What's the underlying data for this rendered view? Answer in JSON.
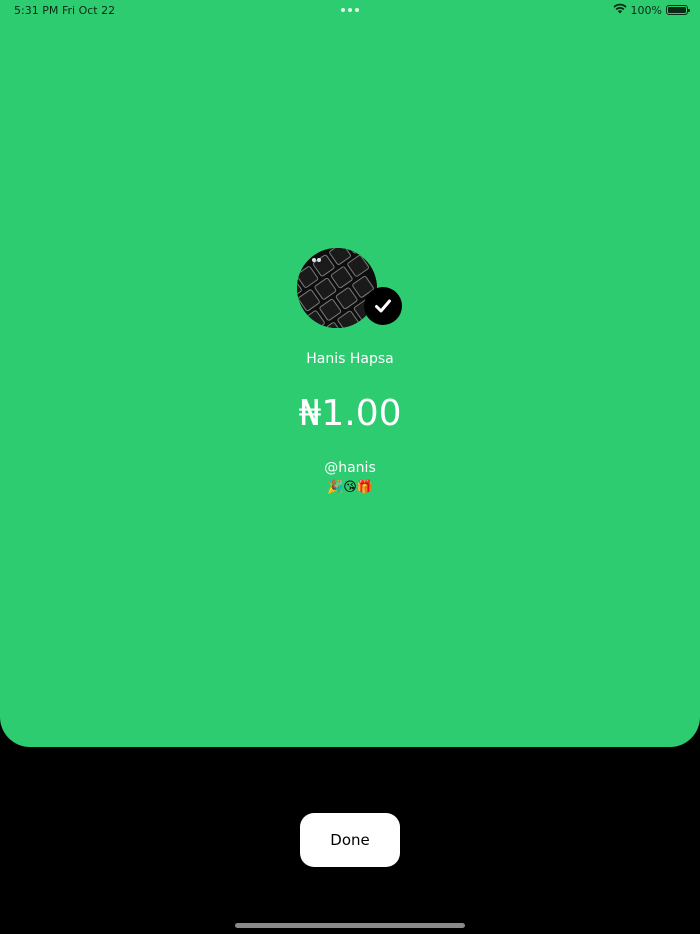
{
  "status_bar": {
    "time": "5:31 PM",
    "date": "Fri Oct 22",
    "battery": "100%",
    "battery_level": 1.0,
    "icons": [
      "multitasking-dots-icon",
      "wifi-icon",
      "battery-icon"
    ]
  },
  "payment": {
    "recipient_name": "Hanis Hapsa",
    "amount": "₦1.00",
    "handle": "@hanis",
    "note_emojis": "🎉😘🎁",
    "avatar_icon": "keyboard-photo-avatar",
    "verified_icon": "checkmark-icon"
  },
  "actions": {
    "done_label": "Done"
  },
  "colors": {
    "accent": "#2ecc71",
    "background": "#000000",
    "text": "#ffffff",
    "button": "#ffffff"
  }
}
